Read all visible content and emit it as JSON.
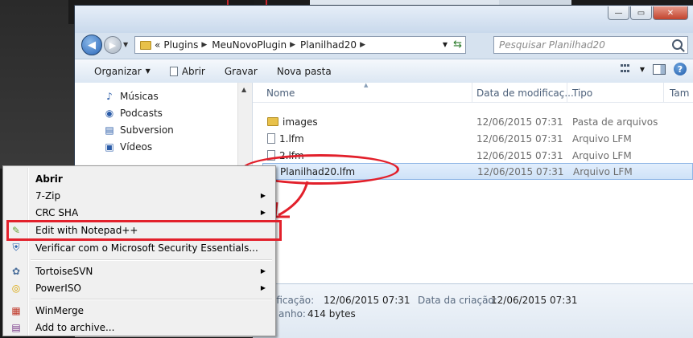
{
  "search": {
    "placeholder": "Pesquisar Planilhad20"
  },
  "breadcrumb": [
    "Plugins",
    "MeuNovoPlugin",
    "Planilhad20"
  ],
  "breadcrumb_prefix": "«",
  "toolbar": {
    "organize": "Organizar",
    "open": "Abrir",
    "burn": "Gravar",
    "new_folder": "Nova pasta"
  },
  "navpane": {
    "items": [
      {
        "label": "Músicas",
        "icon": "music-icon"
      },
      {
        "label": "Podcasts",
        "icon": "podcast-icon"
      },
      {
        "label": "Subversion",
        "icon": "subversion-icon"
      },
      {
        "label": "Vídeos",
        "icon": "video-icon"
      }
    ]
  },
  "columns": {
    "name": "Nome",
    "modified": "Data de modificaç...",
    "type": "Tipo",
    "size": "Tam"
  },
  "files": [
    {
      "name": "images",
      "modified": "12/06/2015 07:31",
      "type": "Pasta de arquivos",
      "icon": "folder-icon"
    },
    {
      "name": "1.lfm",
      "modified": "12/06/2015 07:31",
      "type": "Arquivo LFM",
      "icon": "file-icon"
    },
    {
      "name": "2.lfm",
      "modified": "12/06/2015 07:31",
      "type": "Arquivo LFM",
      "icon": "file-icon"
    },
    {
      "name": "Planilhad20.lfm",
      "modified": "12/06/2015 07:31",
      "type": "Arquivo LFM",
      "icon": "file-icon",
      "selected": true
    }
  ],
  "details": {
    "modified_label": "ificação:",
    "modified_value": "12/06/2015 07:31",
    "created_label": "Data da criação:",
    "created_value": "12/06/2015 07:31",
    "size_label": "anho:",
    "size_value": "414 bytes"
  },
  "context_menu": {
    "open": "Abrir",
    "zip": "7-Zip",
    "crc": "CRC SHA",
    "notepad": "Edit with Notepad++",
    "security": "Verificar com o Microsoft Security Essentials...",
    "tortoise": "TortoiseSVN",
    "poweriso": "PowerISO",
    "winmerge": "WinMerge",
    "archive": "Add to archive..."
  },
  "colors": {
    "highlight": "#e2202b",
    "selection": "#cfe2f8"
  }
}
